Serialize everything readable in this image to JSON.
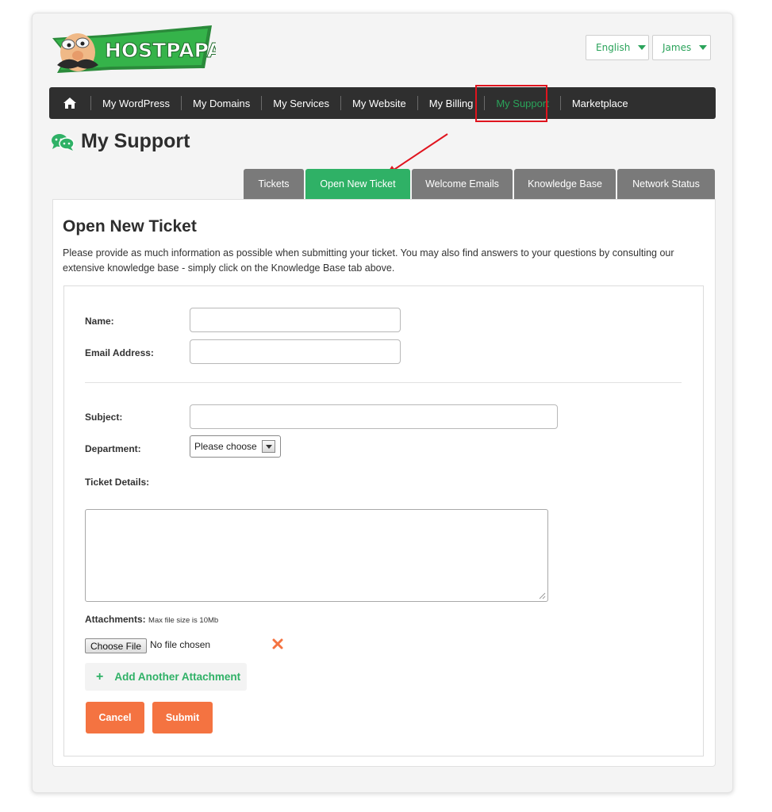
{
  "brand": {
    "logo_text": "HOSTPAPA"
  },
  "top_controls": {
    "language": "English",
    "user": "James"
  },
  "nav": {
    "home_icon": "home-icon",
    "items": [
      {
        "label": "My WordPress"
      },
      {
        "label": "My Domains"
      },
      {
        "label": "My Services"
      },
      {
        "label": "My Website"
      },
      {
        "label": "My Billing"
      },
      {
        "label": "My Support",
        "active": true
      },
      {
        "label": "Marketplace"
      }
    ]
  },
  "page": {
    "title": "My Support",
    "title_icon": "chat-bubbles-icon"
  },
  "tabs": [
    {
      "label": "Tickets"
    },
    {
      "label": "Open New Ticket",
      "active": true
    },
    {
      "label": "Welcome Emails"
    },
    {
      "label": "Knowledge Base"
    },
    {
      "label": "Network Status"
    }
  ],
  "form": {
    "heading": "Open New Ticket",
    "description": "Please provide as much information as possible when submitting your ticket. You may also find answers to your questions by consulting our extensive knowledge base - simply click on the Knowledge Base tab above.",
    "name_label": "Name:",
    "email_label": "Email Address:",
    "subject_label": "Subject:",
    "department_label": "Department:",
    "department_value": "Please choose",
    "details_label": "Ticket Details:",
    "attachments_label": "Attachments:",
    "attachments_note": "Max file size is 10Mb",
    "choose_file": "Choose File",
    "no_file": "No file chosen",
    "add_attachment": "Add Another Attachment",
    "cancel": "Cancel",
    "submit": "Submit"
  },
  "colors": {
    "accent_green": "#2fb166",
    "nav_bg": "#2f2f2f",
    "button_orange": "#f47341",
    "highlight_red": "#e0141e"
  }
}
